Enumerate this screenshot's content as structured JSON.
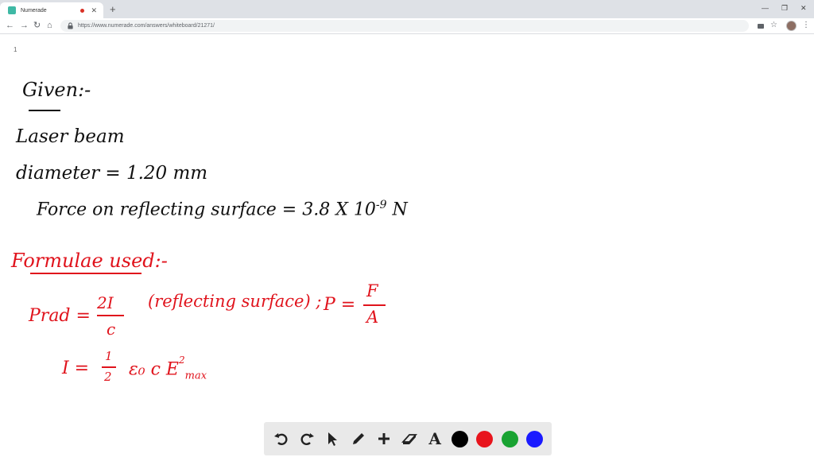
{
  "browser": {
    "tab": {
      "title": "Numerade",
      "close_glyph": "✕",
      "favicon_color": "#3fb9a5",
      "recording_color": "#d93025"
    },
    "new_tab_glyph": "+",
    "window_controls": {
      "minimize": "—",
      "restore": "❐",
      "close": "✕"
    },
    "nav": {
      "back": "←",
      "forward": "→",
      "reload": "↻",
      "home": "⌂"
    },
    "url": "https://www.numerade.com/answers/whiteboard/21271/",
    "toolbar_icons": {
      "cast": "cast-icon",
      "star": "☆",
      "menu": "⋮"
    }
  },
  "whiteboard": {
    "page_number": "1",
    "given": {
      "heading": "Given:-",
      "laser": "Laser beam",
      "diameter": "diameter = 1.20 mm",
      "force_label": "Force on reflecting surface = 3.8 X 10",
      "force_exponent": "-9",
      "force_unit": "N"
    },
    "formulae": {
      "heading": "Formulae used:-",
      "prad_lhs": "Prad =",
      "prad_num": "2I",
      "prad_den": "c",
      "prad_note": "(reflecting surface) ;",
      "pressure_lhs": "P =",
      "pressure_num": "F",
      "pressure_den": "A",
      "intensity_lhs": "I =",
      "intensity_half_num": "1",
      "intensity_half_den": "2",
      "intensity_rhs": "ε₀ c E",
      "intensity_sub": "max",
      "intensity_sup": "2"
    }
  },
  "palette": {
    "tools": [
      "undo-icon",
      "redo-icon",
      "pointer-icon",
      "pen-icon",
      "add-icon",
      "eraser-icon",
      "text-tool"
    ],
    "text_tool_label": "A",
    "colors": [
      "#000000",
      "#e8141c",
      "#19a332",
      "#1a1aff"
    ]
  }
}
